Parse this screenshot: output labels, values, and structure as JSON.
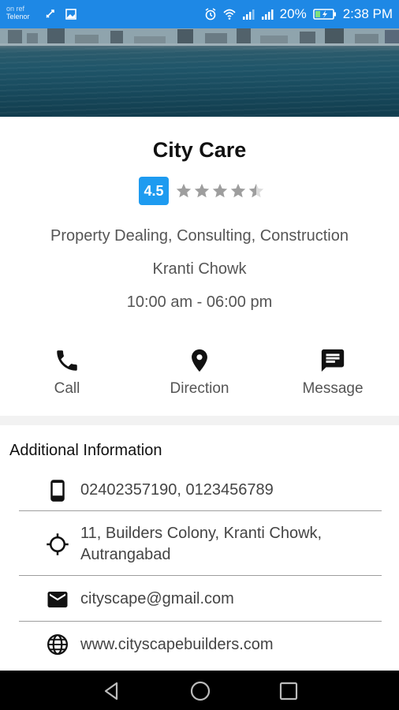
{
  "status_bar": {
    "carrier": "Telenor",
    "carrier_top": "on ref",
    "battery": "20%",
    "time": "2:38 PM",
    "icons": [
      "alarm-icon",
      "wifi-icon",
      "signal-icon",
      "signal-icon",
      "battery-icon"
    ]
  },
  "business": {
    "name": "City Care",
    "rating": "4.5",
    "stars": 4.5,
    "categories": "Property Dealing, Consulting, Construction",
    "location": "Kranti Chowk",
    "hours": "10:00 am - 06:00 pm"
  },
  "actions": {
    "call": "Call",
    "direction": "Direction",
    "message": "Message"
  },
  "additional": {
    "title": "Additional Information",
    "phone": "02402357190, 0123456789",
    "address_line1": "11, Builders Colony, Kranti Chowk,",
    "address_line2": "Autrangabad",
    "email": "cityscape@gmail.com",
    "website": "www.cityscapebuilders.com"
  },
  "colors": {
    "status_bar": "#1e88e5",
    "rating_badge": "#1e9bf0",
    "nav_bar": "#000000"
  }
}
